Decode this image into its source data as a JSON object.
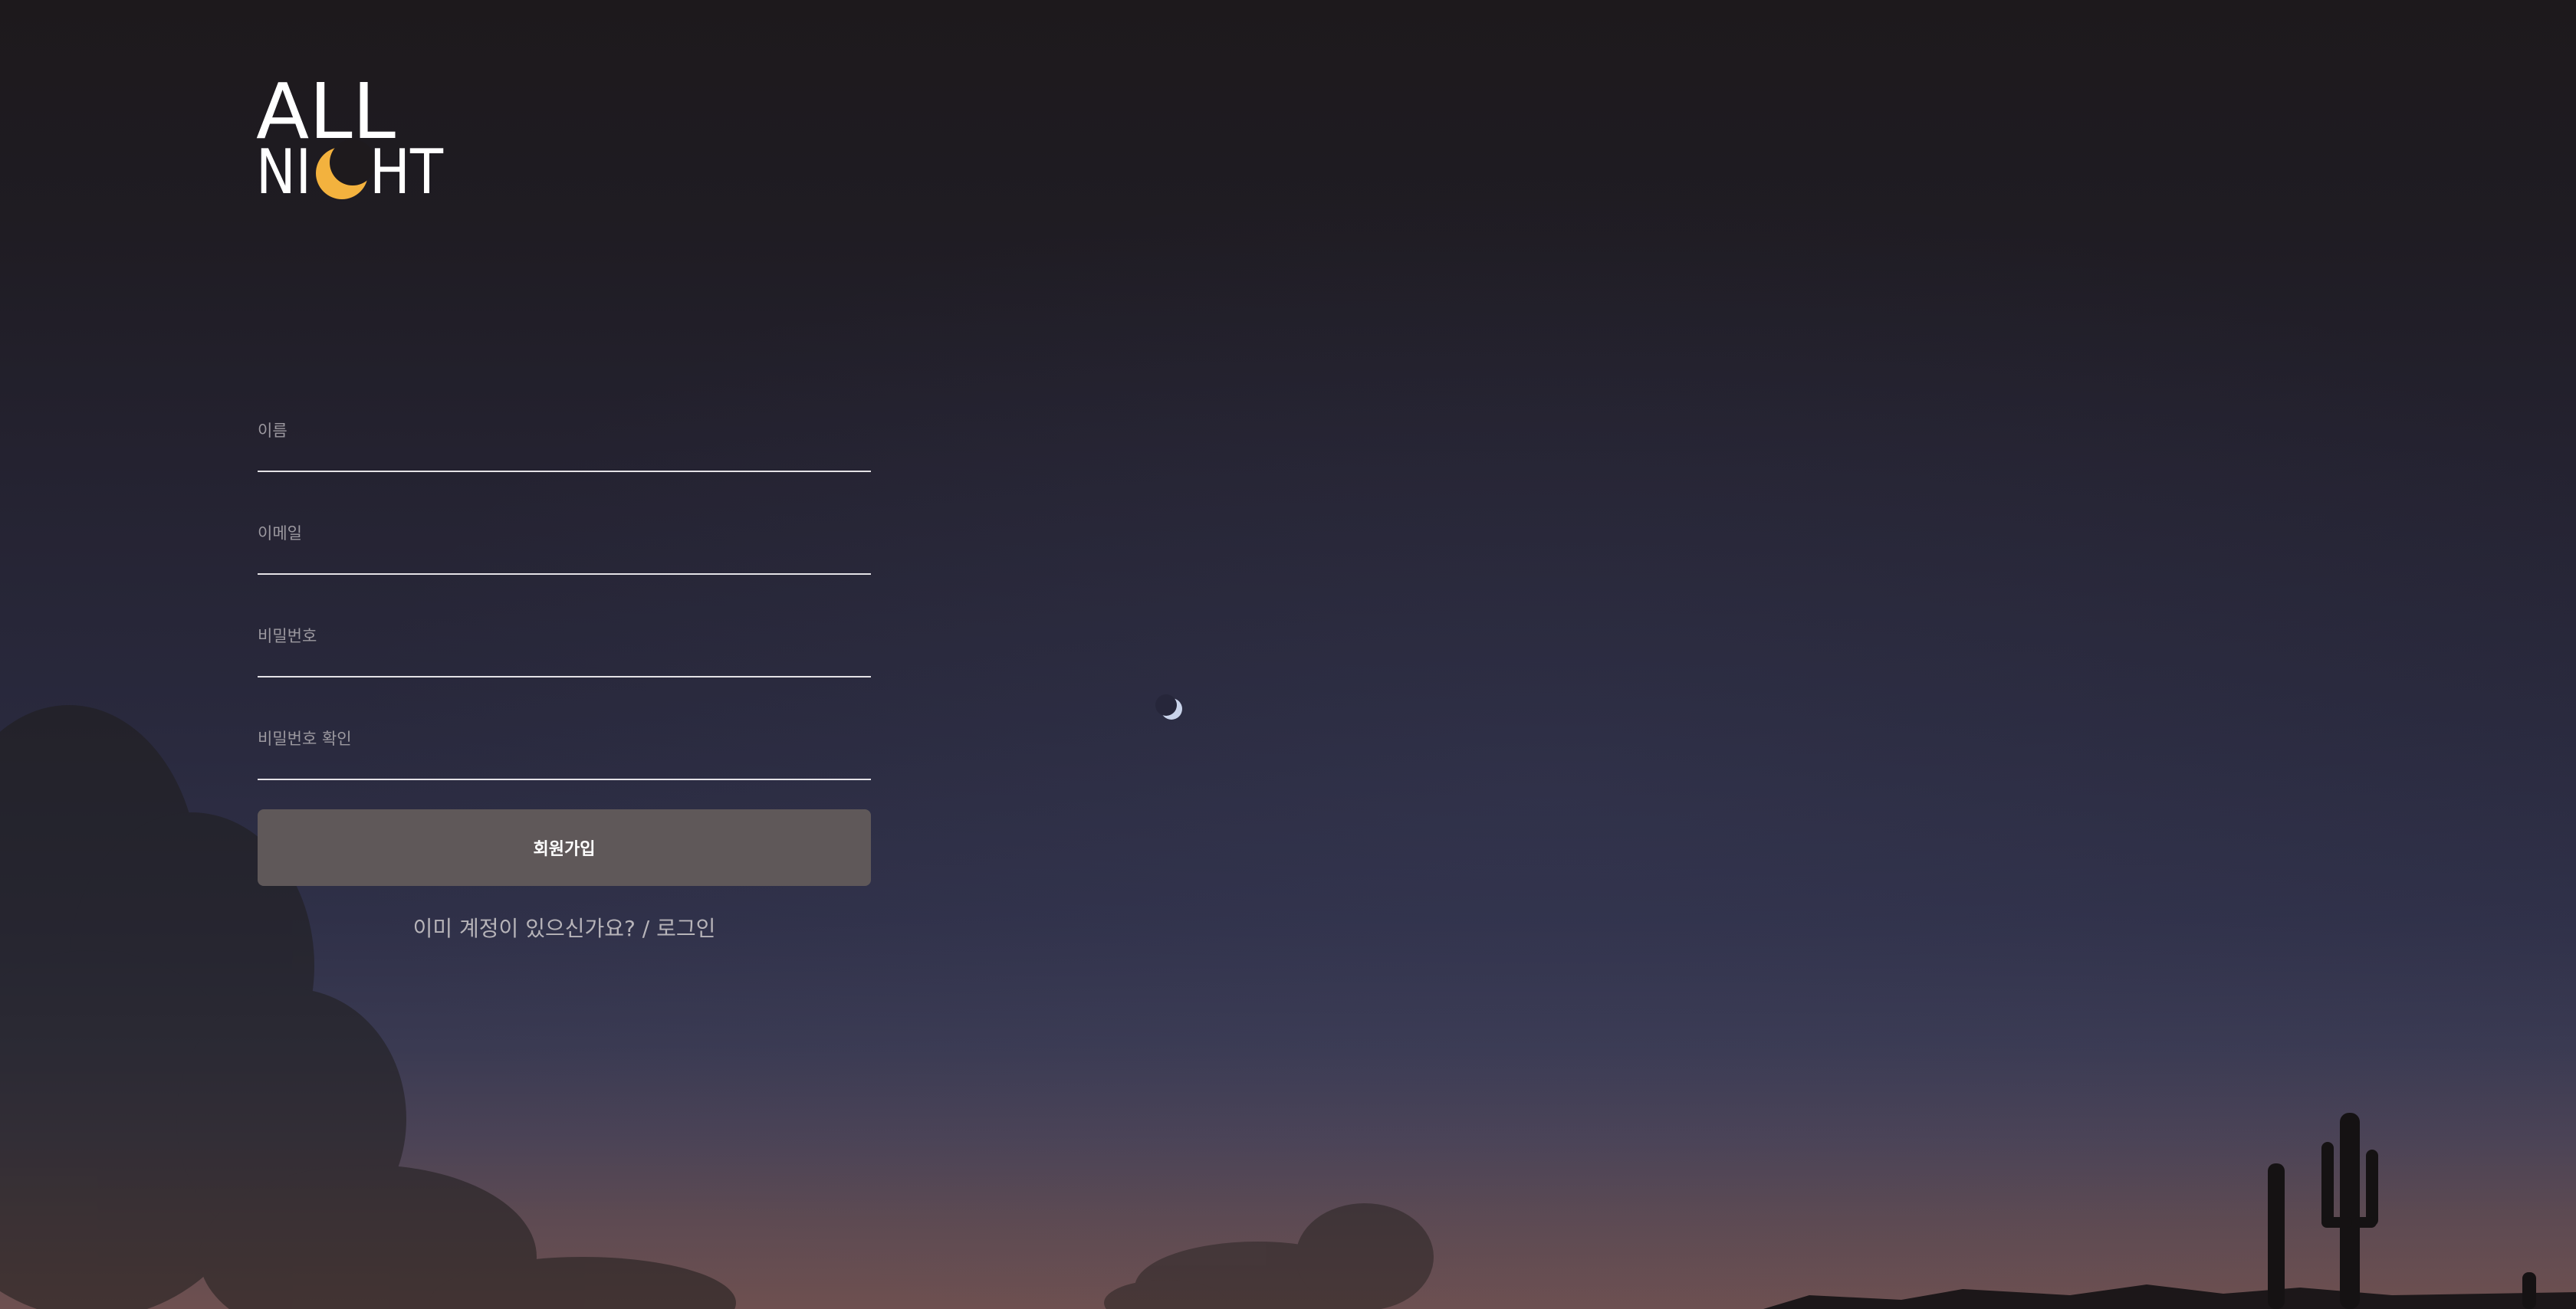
{
  "brand": {
    "logo_line1": "ALL",
    "logo_line2_a": "NI",
    "logo_line2_b": "HT",
    "logo_color": "#ffffff",
    "moon_color": "#f3b23e"
  },
  "form": {
    "name_label": "이름",
    "email_label": "이메일",
    "password_label": "비밀번호",
    "password_confirm_label": "비밀번호 확인",
    "submit_label": "회원가입",
    "login_prompt": "이미 계정이 있으신가요? / 로그인"
  },
  "colors": {
    "button_bg": "#5f5859",
    "underline": "#e4e2e6",
    "label": "#9c99a0"
  }
}
